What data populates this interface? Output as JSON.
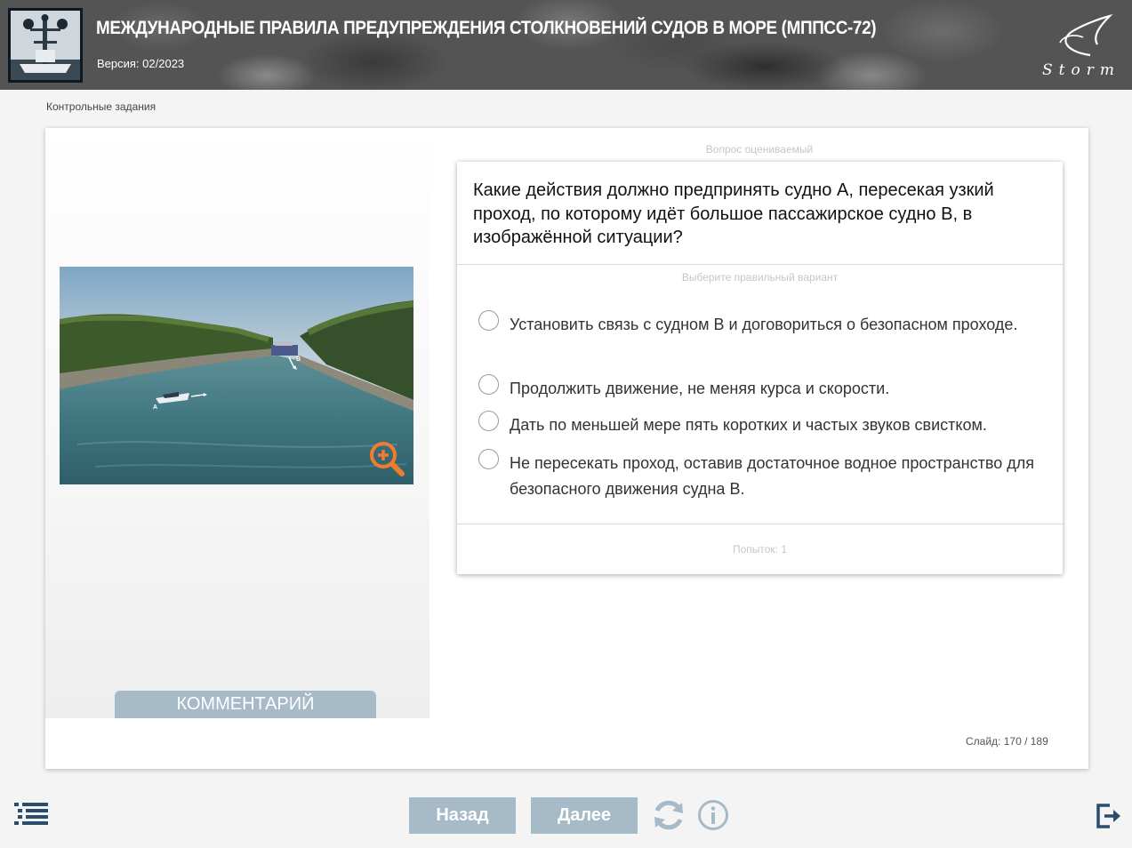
{
  "header": {
    "title": "МЕЖДУНАРОДНЫЕ ПРАВИЛА ПРЕДУПРЕЖДЕНИЯ СТОЛКНОВЕНИЙ СУДОВ В МОРЕ (МППСС-72)",
    "version": "Версия: 02/2023",
    "brand_text": "Storm"
  },
  "breadcrumb": "Контрольные задания",
  "question": {
    "assessed_label": "Вопрос оцениваемый",
    "text": "Какие действия должно предпринять судно А, пересекая узкий проход, по которому идёт большое пассажирское судно В, в изображённой ситуации?",
    "choose_label": "Выберите правильный вариант",
    "options": [
      {
        "label": "Установить связь с судном В и договориться о безопасном проходе.",
        "selected": false
      },
      {
        "label": "Продолжить движение, не меняя курса и скорости.",
        "selected": false
      },
      {
        "label": "Дать по меньшей мере пять коротких и частых звуков свистком.",
        "selected": false
      },
      {
        "label": "Не пересекать проход, оставив достаточное водное пространство для безопасного движения судна В.",
        "selected": false
      }
    ],
    "attempts": "Попыток: 1"
  },
  "image": {
    "label_a": "A",
    "label_b": "B"
  },
  "comment_button": "КОММЕНТАРИЙ",
  "slide": {
    "label": "Слайд:",
    "counter": "170 / 189"
  },
  "nav": {
    "back": "Назад",
    "next": "Далее"
  },
  "colors": {
    "accent_button": "#a6bac7",
    "zoom_icon": "#f07d2e",
    "icon_blue": "#2a4d6e"
  }
}
